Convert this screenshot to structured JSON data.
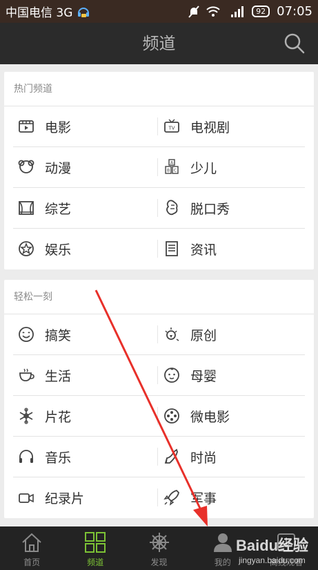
{
  "status_bar": {
    "carrier": "中国电信 3G",
    "battery": "92",
    "time": "07:05"
  },
  "header": {
    "title": "频道"
  },
  "sections": [
    {
      "title": "热门频道",
      "rows": [
        [
          {
            "label": "电影",
            "icon": "film-icon"
          },
          {
            "label": "电视剧",
            "icon": "tv-icon"
          }
        ],
        [
          {
            "label": "动漫",
            "icon": "bear-icon"
          },
          {
            "label": "少儿",
            "icon": "abc-blocks-icon"
          }
        ],
        [
          {
            "label": "综艺",
            "icon": "stage-icon"
          },
          {
            "label": "脱口秀",
            "icon": "talk-icon"
          }
        ],
        [
          {
            "label": "娱乐",
            "icon": "star-icon"
          },
          {
            "label": "资讯",
            "icon": "news-icon"
          }
        ]
      ]
    },
    {
      "title": "轻松一刻",
      "rows": [
        [
          {
            "label": "搞笑",
            "icon": "smile-icon"
          },
          {
            "label": "原创",
            "icon": "bulb-icon"
          }
        ],
        [
          {
            "label": "生活",
            "icon": "cup-icon"
          },
          {
            "label": "母婴",
            "icon": "baby-icon"
          }
        ],
        [
          {
            "label": "片花",
            "icon": "snowflake-icon"
          },
          {
            "label": "微电影",
            "icon": "reel-icon"
          }
        ],
        [
          {
            "label": "音乐",
            "icon": "headphones-icon"
          },
          {
            "label": "时尚",
            "icon": "heel-icon"
          }
        ],
        [
          {
            "label": "纪录片",
            "icon": "camera-icon"
          },
          {
            "label": "军事",
            "icon": "rocket-icon"
          }
        ]
      ]
    }
  ],
  "tab_bar": {
    "tabs": [
      {
        "label": "首页",
        "icon": "home-icon",
        "active": false
      },
      {
        "label": "频道",
        "icon": "grid-icon",
        "active": true
      },
      {
        "label": "发现",
        "icon": "helm-icon",
        "active": false
      },
      {
        "label": "我的",
        "icon": "user-icon",
        "active": false
      },
      {
        "label": "离线观看",
        "icon": "download-icon",
        "active": false
      }
    ]
  },
  "colors": {
    "accent": "#7cc235",
    "arrow": "#e8302a",
    "navbar": "#2b2b2b",
    "tabbar": "#232323"
  },
  "watermark": {
    "brand": "Baidu经验",
    "url": "jingyan.baidu.com"
  }
}
